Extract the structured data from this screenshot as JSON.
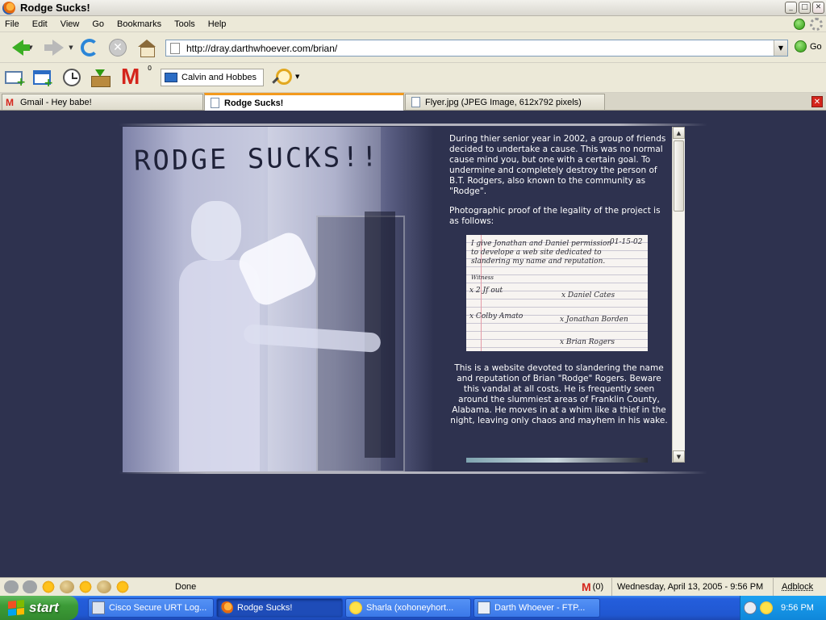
{
  "window": {
    "title": "Rodge Sucks!",
    "controls": [
      "_",
      "□",
      "✕"
    ]
  },
  "menu": [
    "File",
    "Edit",
    "View",
    "Go",
    "Bookmarks",
    "Tools",
    "Help"
  ],
  "navigation": {
    "url": "http://dray.darthwhoever.com/brian/",
    "go_label": "Go"
  },
  "bookmarks_toolbar": {
    "gmail_count": "0",
    "bookmark_label": "Calvin and Hobbes"
  },
  "tabs": [
    {
      "label": "Gmail - Hey babe!",
      "active": false
    },
    {
      "label": "Rodge Sucks!",
      "active": true
    },
    {
      "label": "Flyer.jpg (JPEG Image, 612x792 pixels)",
      "active": false
    }
  ],
  "page": {
    "heading": "RODGE SUCKS!!",
    "paragraph1": "During thier senior year in 2002, a group of friends decided to undertake a cause.  This was no normal cause mind you, but one with a certain goal.  To undermine and completely destroy the person of B.T. Rodgers, also known to the community as \"Rodge\".",
    "paragraph2": "Photographic proof of the legality of the project is as follows:",
    "paragraph3": "This is a website devoted to slandering the name and reputation of Brian \"Rodge\" Rogers.  Beware this vandal at all costs.  He is frequently seen around the slummiest areas of Franklin County, Alabama.  He moves in at a whim like a thief in the night, leaving only chaos and mayhem in his wake.",
    "permission_slip": {
      "date": "01-15-02",
      "line1": "I give Jonathan and Daniel permission",
      "line2": "to develope a web site dedicated to",
      "line3": "slandering my name and reputation.",
      "witness": "Witness",
      "sig1": "x Daniel Cates",
      "sig2": "x 2 Jf out",
      "sig3": "x Colby Amato",
      "sig4": "x Jonathan Borden",
      "sig5": "x Brian Rogers"
    }
  },
  "status": {
    "text": "Done",
    "gmail_count": "(0)",
    "datetime": "Wednesday, April 13, 2005 - 9:56 PM",
    "adblock": "Adblock"
  },
  "taskbar": {
    "start_label": "start",
    "tasks": [
      {
        "label": "Cisco Secure URT Log...",
        "active": false
      },
      {
        "label": "Rodge Sucks!",
        "active": true
      },
      {
        "label": "Sharla  (xohoneyhort...",
        "active": false
      },
      {
        "label": "Darth Whoever - FTP...",
        "active": false
      }
    ],
    "clock": "9:56 PM"
  },
  "colors": {
    "page_background": "#2E324F",
    "tab_accent": "#F39A1D",
    "taskbar_blue": "#245EDC",
    "start_green": "#3C9B37"
  }
}
